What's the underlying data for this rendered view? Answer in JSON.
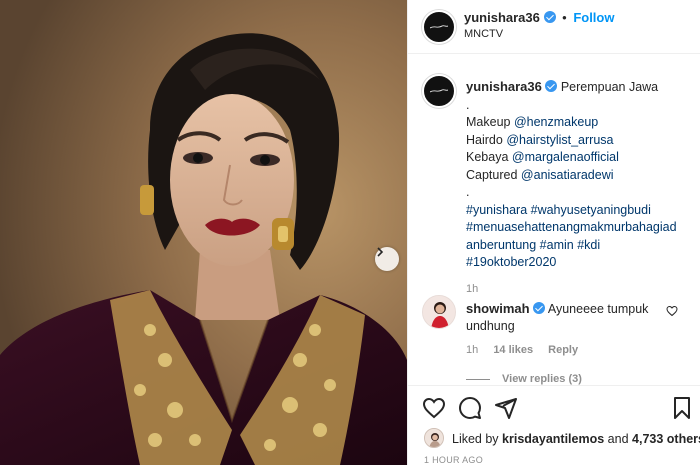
{
  "post": {
    "username": "yunishara36",
    "follow_label": "Follow",
    "location": "MNCTV",
    "separator": "•"
  },
  "caption": {
    "username": "yunishara36",
    "title": "Perempuan Jawa",
    "dot": ".",
    "makeup_label": "Makeup",
    "makeup_handle": "@henzmakeup",
    "hairdo_label": "Hairdo",
    "hairdo_handle": "@hairstylist_arrusa",
    "kebaya_label": "Kebaya",
    "kebaya_handle": "@margalenaofficial",
    "captured_label": "Captured",
    "captured_handle": "@anisatiaradewi",
    "dot2": ".",
    "tags_line1": "#yunishara #wahyusetyaningbudi",
    "tags_line2": "#menuasehattenangmakmurbahagiad",
    "tags_line3": "anberuntung #amin #kdi",
    "tags_line4": "#19oktober2020",
    "time": "1h"
  },
  "comment": {
    "username": "showimah",
    "text_line1": "Ayuneeee tumpuk",
    "text_line2": "undhung",
    "time": "1h",
    "likes": "14 likes",
    "reply_label": "Reply",
    "view_replies": "View replies (3)"
  },
  "engagement": {
    "liked_prefix": "Liked by",
    "liked_user": "krisdayantilemos",
    "liked_and": "and",
    "liked_count": "4,733 others",
    "time_ago": "1 HOUR AGO"
  },
  "icons": {
    "heart": "heart-icon",
    "comment": "comment-icon",
    "share": "share-icon",
    "save": "bookmark-icon",
    "next": "chevron-right-icon"
  },
  "colors": {
    "link": "#00376b",
    "follow": "#0095f6",
    "verified": "#3897f0",
    "muted": "#8e8e8e"
  }
}
